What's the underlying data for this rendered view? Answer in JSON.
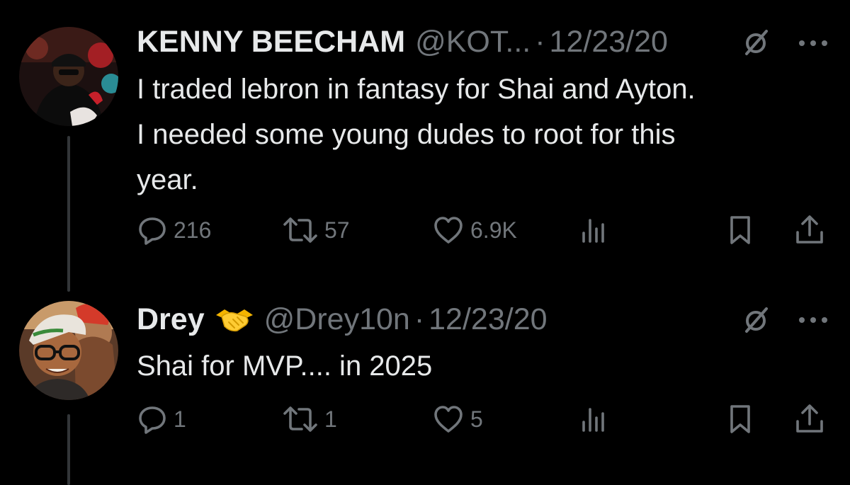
{
  "tweets": [
    {
      "display_name": "KENNY BEECHAM",
      "handle": "@KOT...",
      "separator": "·",
      "date": "12/23/20",
      "text": "I traded lebron in fantasy for Shai and Ayton. \nI needed some young dudes to root for this \nyear.",
      "counts": {
        "replies": "216",
        "retweets": "57",
        "likes": "6.9K"
      },
      "avatar_colors": [
        "#2a1512",
        "#8b1d1d",
        "#121212"
      ]
    },
    {
      "display_name": "Drey",
      "emoji": "handshake-emoji",
      "handle": "@Drey10n",
      "separator": "·",
      "date": "12/23/20",
      "text": "Shai for MVP.... in 2025",
      "counts": {
        "replies": "1",
        "retweets": "1",
        "likes": "5"
      },
      "avatar_colors": [
        "#6a3b26",
        "#d84b2f",
        "#c7a07c"
      ]
    }
  ],
  "icons": {
    "reply": "speech-bubble-icon",
    "retweet": "retweet-arrows-icon",
    "like": "heart-icon",
    "views": "bar-chart-icon",
    "bookmark": "bookmark-icon",
    "share": "share-upload-icon",
    "grok": "slashed-circle-icon",
    "more": "three-dots-icon"
  },
  "colors": {
    "background": "#000000",
    "primary_text": "#e7e9ea",
    "secondary_text": "#71767b",
    "thread_line": "#333639"
  }
}
